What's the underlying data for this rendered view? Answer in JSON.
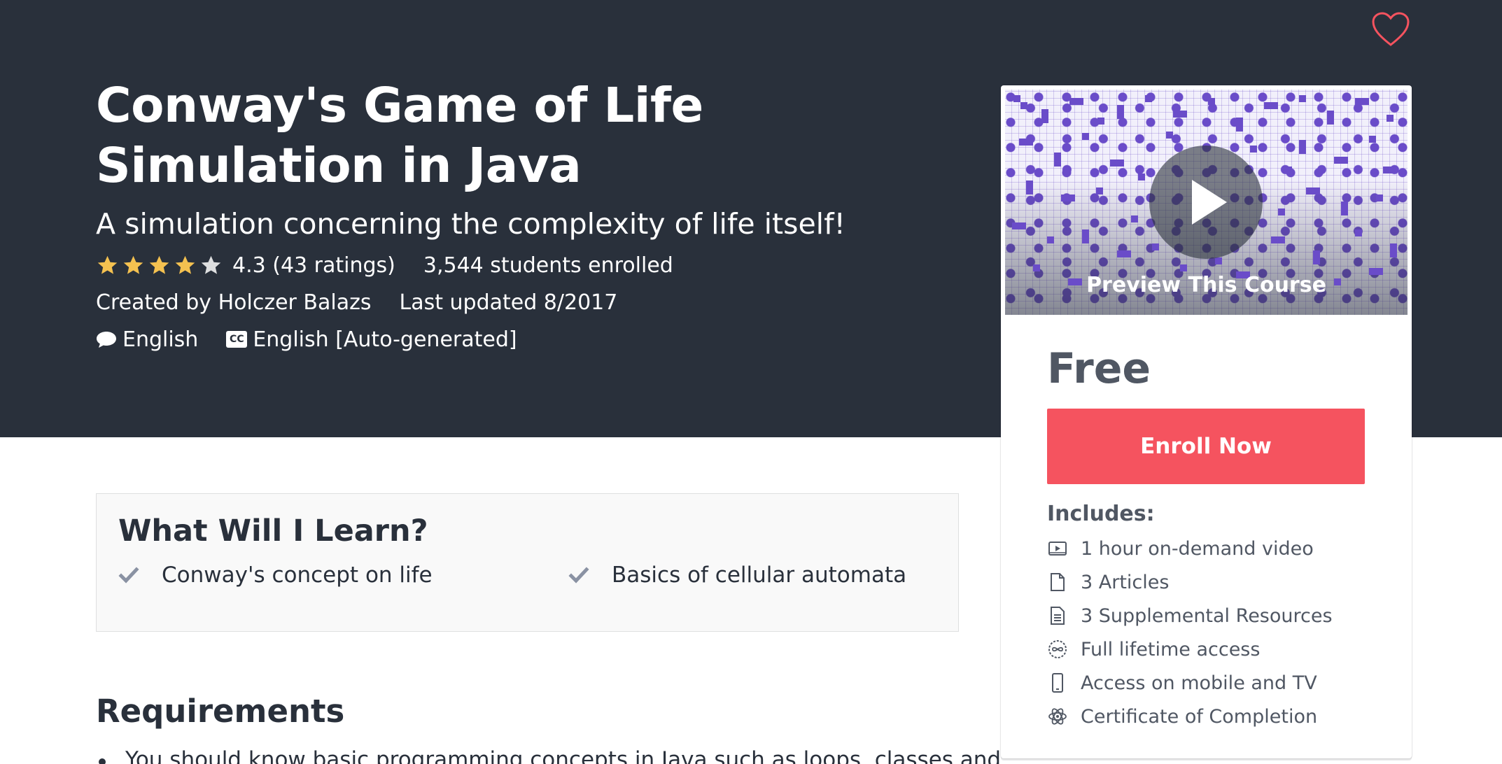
{
  "course": {
    "title": "Conway's Game of Life Simulation in Java",
    "subtitle": "A simulation concerning the complexity of life itself!",
    "rating_value": 4.3,
    "rating_text": "4.3 (43 ratings)",
    "enrolled": "3,544 students enrolled",
    "created_by": "Created by Holczer Balazs",
    "last_updated": "Last updated 8/2017",
    "language": "English",
    "captions": "English [Auto-generated]",
    "cc_badge": "CC"
  },
  "sidebar": {
    "preview_label": "Preview This Course",
    "price": "Free",
    "enroll_label": "Enroll Now",
    "includes_title": "Includes:",
    "includes": [
      {
        "icon": "video-icon",
        "text": "1 hour on-demand video"
      },
      {
        "icon": "article-icon",
        "text": "3 Articles"
      },
      {
        "icon": "resource-icon",
        "text": "3 Supplemental Resources"
      },
      {
        "icon": "infinity-icon",
        "text": "Full lifetime access"
      },
      {
        "icon": "mobile-icon",
        "text": "Access on mobile and TV"
      },
      {
        "icon": "certificate-icon",
        "text": "Certificate of Completion"
      }
    ]
  },
  "learn": {
    "title": "What Will I Learn?",
    "items": [
      "Conway's concept on life",
      "Basics of cellular automata"
    ]
  },
  "requirements": {
    "title": "Requirements",
    "items": [
      "You should know basic programming concepts in Java such as loops, classes and"
    ]
  },
  "colors": {
    "hero_bg": "#29303b",
    "accent": "#f5535f",
    "star": "#f4c150",
    "star_empty": "#dedfe0"
  }
}
